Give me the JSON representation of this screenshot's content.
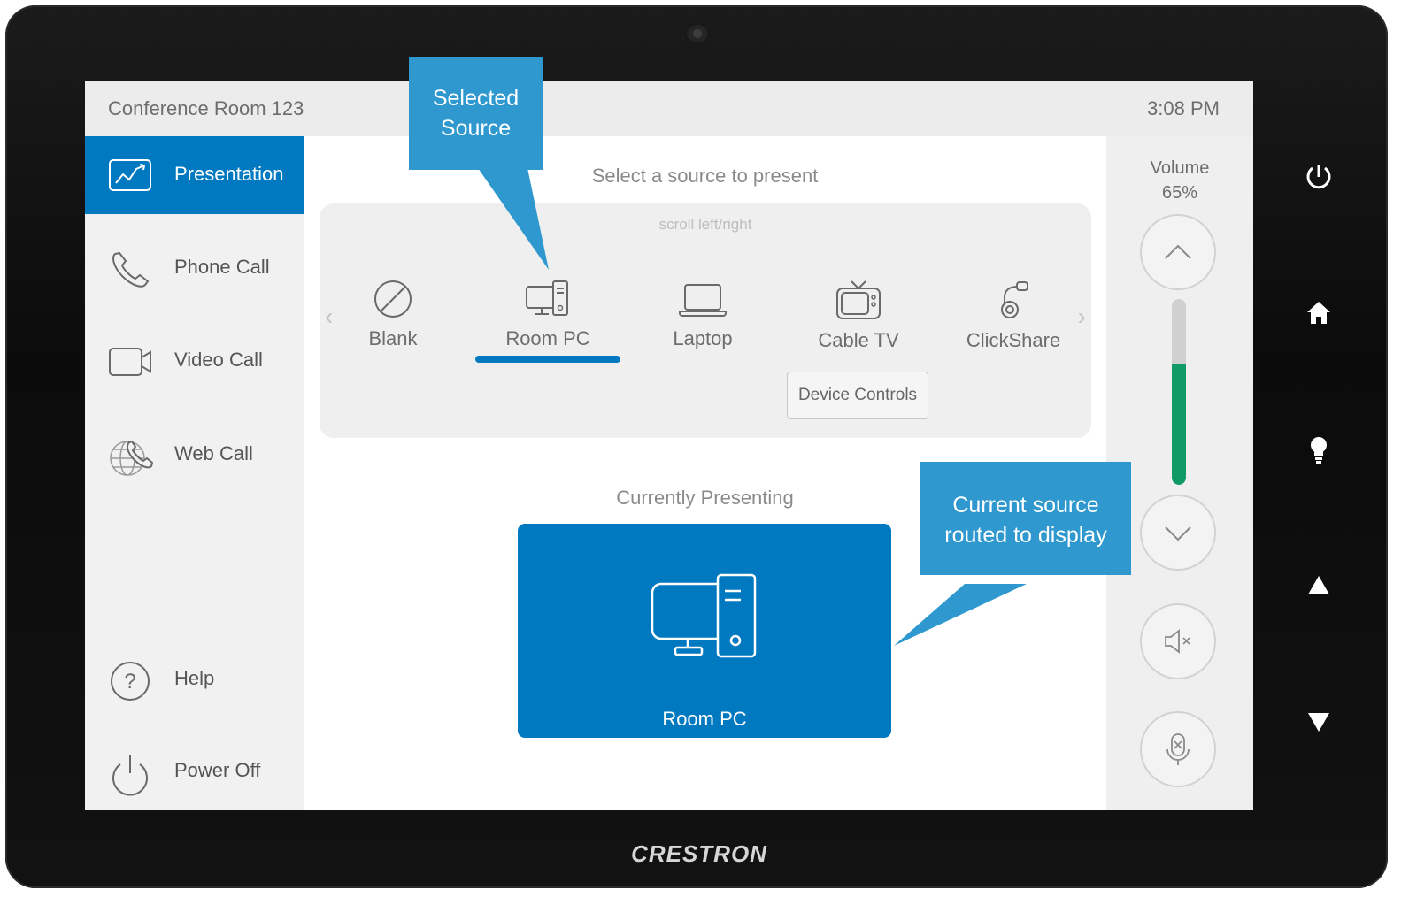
{
  "device": {
    "brand": "CRESTRON"
  },
  "header": {
    "room_name": "Conference Room 123",
    "time": "3:08 PM"
  },
  "sidebar": {
    "items": [
      {
        "label": "Presentation",
        "icon": "presentation-chart-icon",
        "active": true
      },
      {
        "label": "Phone Call",
        "icon": "phone-icon",
        "active": false
      },
      {
        "label": "Video Call",
        "icon": "video-camera-icon",
        "active": false
      },
      {
        "label": "Web Call",
        "icon": "globe-phone-icon",
        "active": false
      },
      {
        "label": "Help",
        "icon": "help-circle-icon",
        "active": false
      },
      {
        "label": "Power Off",
        "icon": "power-icon",
        "active": false
      }
    ]
  },
  "main": {
    "prompt": "Select a source to present",
    "scroll_hint": "scroll left/right",
    "sources": [
      {
        "label": "Blank",
        "icon": "blank-icon",
        "selected": false
      },
      {
        "label": "Room PC",
        "icon": "desktop-pc-icon",
        "selected": true
      },
      {
        "label": "Laptop",
        "icon": "laptop-icon",
        "selected": false
      },
      {
        "label": "Cable TV",
        "icon": "tv-icon",
        "selected": false
      },
      {
        "label": "ClickShare",
        "icon": "clickshare-icon",
        "selected": false
      }
    ],
    "device_controls_label": "Device Controls",
    "current_label": "Currently Presenting",
    "current_source": "Room PC"
  },
  "volume": {
    "title": "Volume",
    "level_text": "65%",
    "level": 0.65
  },
  "callouts": {
    "selected": {
      "line1": "Selected",
      "line2": "Source"
    },
    "current": {
      "line1": "Current source",
      "line2": "routed to display"
    }
  },
  "colors": {
    "accent": "#0079c1",
    "volume_fill": "#109a66",
    "callout": "#2e98cf"
  }
}
